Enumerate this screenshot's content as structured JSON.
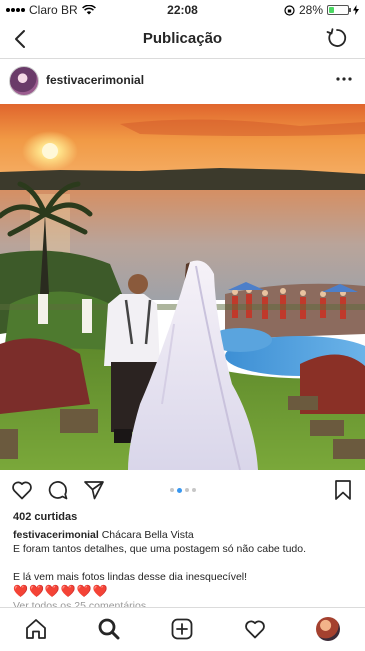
{
  "status_bar": {
    "carrier": "Claro BR",
    "time": "22:08",
    "battery": "28%",
    "battery_level": 0.28
  },
  "nav": {
    "title": "Publicação"
  },
  "post": {
    "username": "festivacerimonial",
    "likes": "402 curtidas",
    "caption": {
      "username": "festivacerimonial",
      "location": "Chácara Bella Vista",
      "line1": "E foram tantos detalhes, que uma postagem só não cabe tudo.",
      "line2": "E lá vem mais fotos lindas desse dia inesquecível!",
      "hearts": "❤️❤️❤️❤️❤️❤️"
    },
    "comments_link": "Ver todos os 25 comentários",
    "carousel": {
      "count": 4,
      "active": 2
    }
  },
  "icons": {
    "back": "chevron-left-icon",
    "refresh": "refresh-icon",
    "more": "more-icon",
    "like": "heart-icon",
    "comment": "comment-icon",
    "share": "send-icon",
    "save": "bookmark-icon",
    "home": "home-icon",
    "search": "search-icon",
    "add": "add-post-icon",
    "activity": "heart-icon",
    "profile": "profile-avatar"
  },
  "colors": {
    "accent": "#3897f0",
    "heart": "#e0243a",
    "battery": "#4cd964"
  }
}
